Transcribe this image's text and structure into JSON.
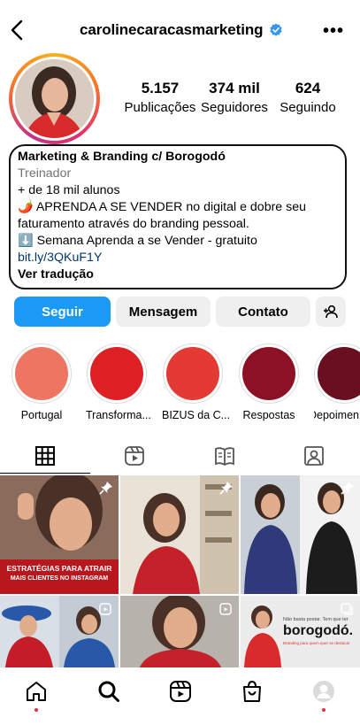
{
  "header": {
    "username": "carolinecaracasmarketing",
    "verified": true,
    "back_icon": "chevron-left-icon",
    "more_icon": "more-horizontal-icon"
  },
  "profile": {
    "stats": [
      {
        "value": "5.157",
        "label": "Publicações"
      },
      {
        "value": "374 mil",
        "label": "Seguidores"
      },
      {
        "value": "624",
        "label": "Seguindo"
      }
    ],
    "bio": {
      "name": "Marketing & Branding c/ Borogodó",
      "category": "Treinador",
      "line1": "+ de 18 mil alunos",
      "line2": "🌶️ APRENDA A SE VENDER no digital e dobre seu",
      "line3": "faturamento através do branding pessoal.",
      "line4": "⬇️ Semana Aprenda a se Vender - gratuito",
      "link": "bit.ly/3QKuF1Y",
      "translate": "Ver tradução"
    }
  },
  "actions": {
    "follow": "Seguir",
    "message": "Mensagem",
    "contact": "Contato",
    "add_icon": "add-person-icon"
  },
  "highlights": [
    {
      "label": "Portugal",
      "color": "#ef7563"
    },
    {
      "label": "Transforma...",
      "color": "#dd2023"
    },
    {
      "label": "BIZUS da C...",
      "color": "#e33b33"
    },
    {
      "label": "Respostas",
      "color": "#8d1124"
    },
    {
      "label": "Depoimen",
      "color": "#6a0e21"
    }
  ],
  "tabs": [
    "grid-icon",
    "reels-icon",
    "guide-icon",
    "tagged-icon"
  ],
  "posts": [
    {
      "caption_line1": "ESTRATÉGIAS PARA ATRAIR",
      "caption_line2": "MAIS CLIENTES NO INSTAGRAM",
      "pinned": true
    },
    {
      "pinned": true
    },
    {
      "pinned": true
    },
    {
      "reel": true
    },
    {
      "reel": true
    },
    {
      "brand_tagline": "Não basta postar. Tem que ter",
      "brand_word": "borogodó.",
      "brand_small": "Branding para quem quer se destacar"
    }
  ],
  "bottom_nav": [
    "home-icon",
    "search-icon",
    "reels-icon",
    "shop-icon",
    "profile-icon"
  ],
  "colors": {
    "accent": "#1a9af5",
    "notification": "#ed2a4a"
  }
}
